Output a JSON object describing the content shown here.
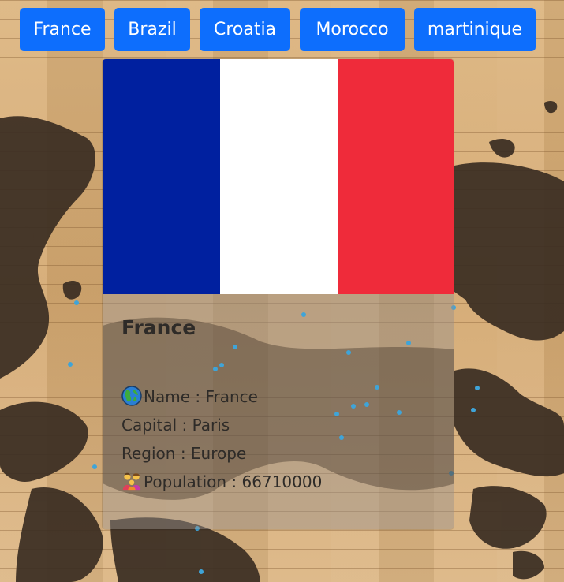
{
  "buttons": [
    {
      "label": "France"
    },
    {
      "label": "Brazil"
    },
    {
      "label": "Croatia"
    },
    {
      "label": "Morocco"
    },
    {
      "label": "martinique"
    }
  ],
  "card": {
    "flag": {
      "colors": [
        "#00209f",
        "#ffffff",
        "#ef2b3a"
      ]
    },
    "title": "France",
    "name_label": "Name : ",
    "name_value": "France",
    "capital_label": "Capital : ",
    "capital_value": "Paris",
    "region_label": "Region : ",
    "region_value": "Europe",
    "population_label": "Population : ",
    "population_value": "66710000",
    "name_icon": "globe-americas-icon",
    "population_icon": "family-icon"
  },
  "theme": {
    "button_color": "#0d6efd",
    "button_text_color": "#ffffff"
  }
}
